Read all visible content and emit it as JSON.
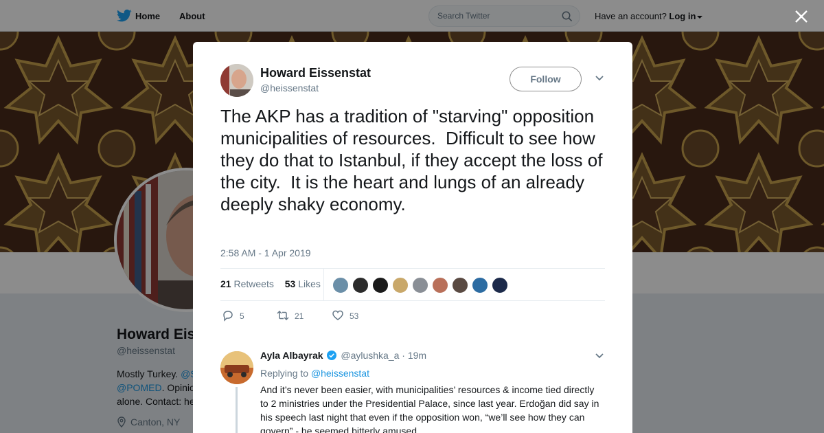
{
  "nav": {
    "home_label": "Home",
    "about_label": "About",
    "search_placeholder": "Search Twitter",
    "have_account": "Have an account?",
    "login_label": "Log in"
  },
  "profile": {
    "name": "Howard Eis",
    "handle": "@heissenstat",
    "bio_prefix": "Mostly Turkey.",
    "bio_link1": "@S",
    "bio_link2": "@POMED",
    "bio_mid": ". Opinio",
    "bio_line3": "alone. Contact: he",
    "location": "Canton, NY"
  },
  "tweet": {
    "author_name": "Howard Eissenstat",
    "author_handle": "@heissenstat",
    "follow_label": "Follow",
    "text": "The AKP has a tradition of \"starving\" opposition municipalities of resources.  Difficult to see how they do that to Istanbul, if they accept the loss of the city.  It is the heart and lungs of an already deeply shaky economy.",
    "timestamp": "2:58 AM - 1 Apr 2019",
    "retweets_count": "21",
    "retweets_label": "Retweets",
    "likes_count": "53",
    "likes_label": "Likes",
    "reply_action_count": "5",
    "retweet_action_count": "21",
    "like_action_count": "53",
    "liker_colors": [
      "#6b8fa8",
      "#2b2b2b",
      "#1a1a1a",
      "#c9a86a",
      "#8a8f96",
      "#b9705a",
      "#5a4a42",
      "#2d6ca2",
      "#1c2a4a"
    ]
  },
  "reply": {
    "name": "Ayla Albayrak",
    "handle": "@aylushka_a",
    "separator": "·",
    "time": "19m",
    "replying_prefix": "Replying to",
    "replying_to": "@heissenstat",
    "text": "And it’s never been easier, with municipalities’ resources & income tied directly to 2 ministries under the Presidential Palace, since last year. Erdoğan did say in his speech last night that even if the opposition won, “we’ll see how they can govern” - he seemed bitterly amused."
  },
  "colors": {
    "accent": "#1da1f2",
    "link": "#1b95e0",
    "text_secondary": "#657786"
  }
}
